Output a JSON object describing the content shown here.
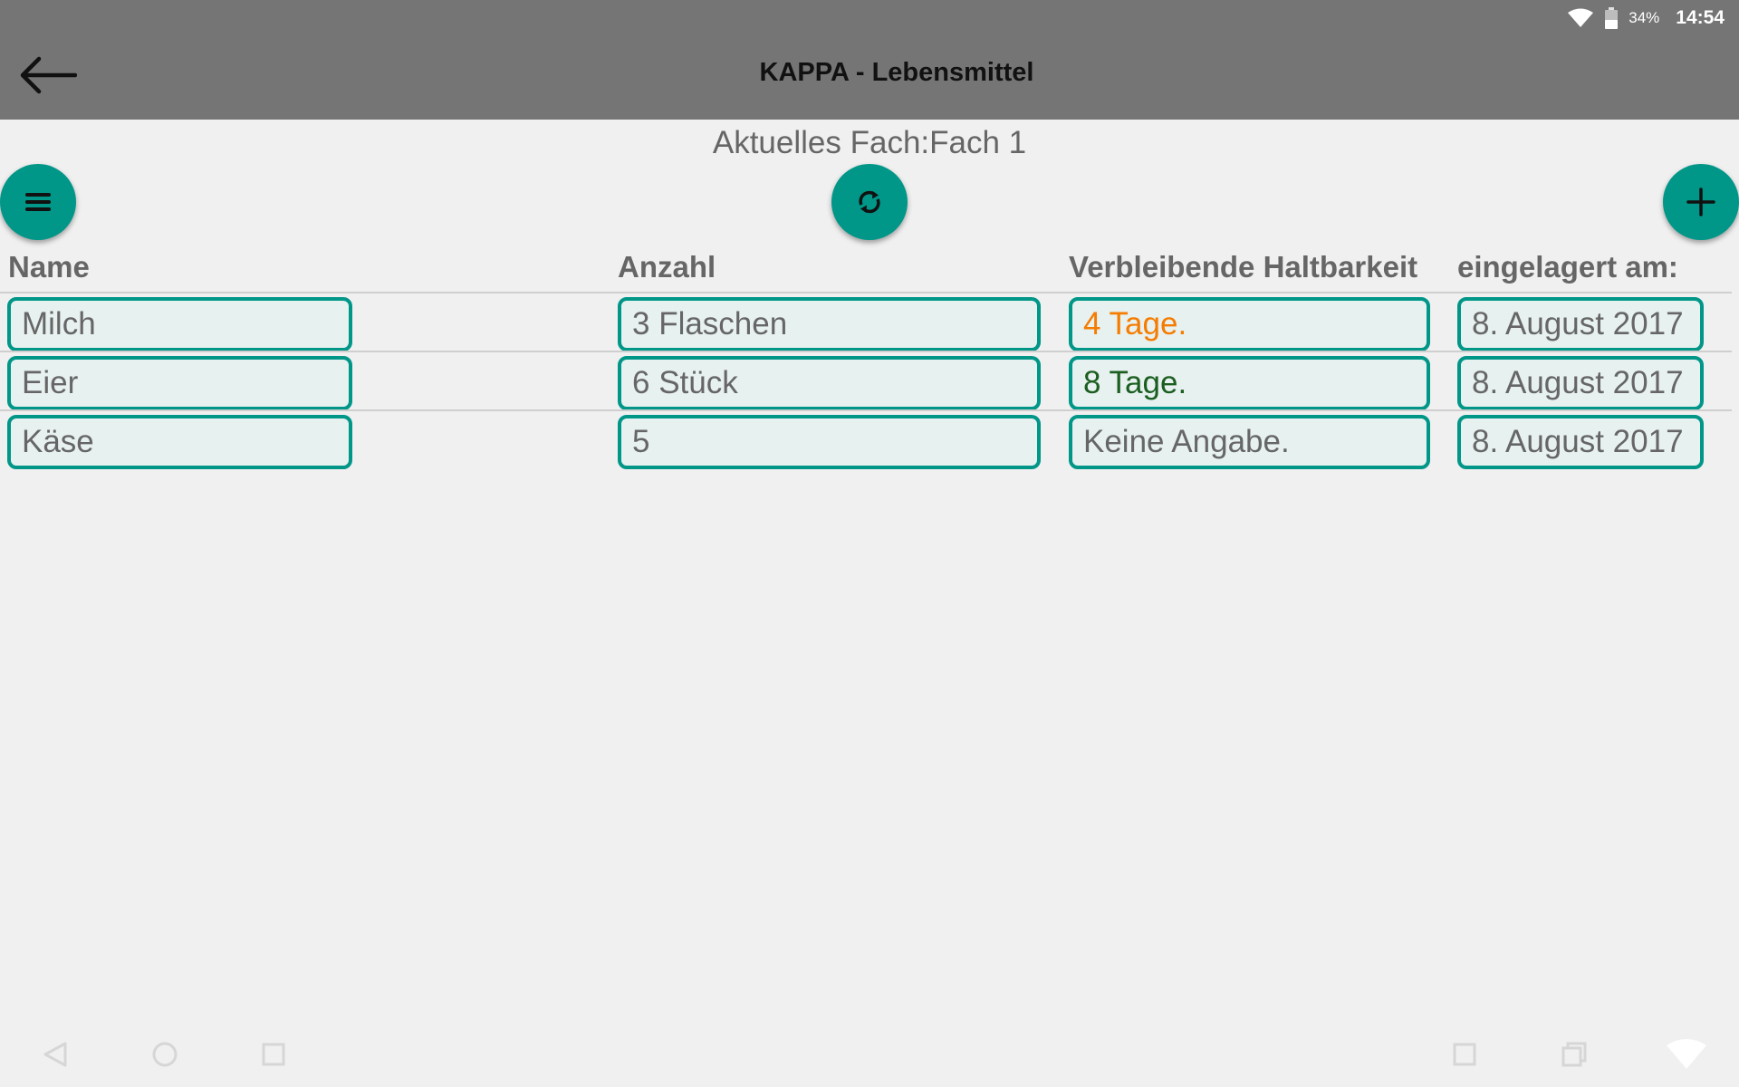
{
  "status": {
    "battery_pct": "34%",
    "time": "14:54"
  },
  "appbar": {
    "title": "KAPPA - Lebensmittel"
  },
  "current_compartment": "Aktuelles Fach:Fach 1",
  "colors": {
    "accent": "#009688",
    "appbar": "#757575",
    "expiry_warning": "#f57c00",
    "expiry_ok": "#1b5e20"
  },
  "table": {
    "headers": {
      "name": "Name",
      "amount": "Anzahl",
      "shelf_life": "Verbleibende Haltbarkeit",
      "stored_on": "eingelagert am:"
    },
    "rows": [
      {
        "name": "Milch",
        "amount": "3 Flaschen",
        "shelf_life": "4 Tage.",
        "stored_on": "8. August 2017"
      },
      {
        "name": "Eier",
        "amount": "6 Stück",
        "shelf_life": "8 Tage.",
        "stored_on": "8. August 2017"
      },
      {
        "name": "Käse",
        "amount": "5",
        "shelf_life": "Keine Angabe.",
        "stored_on": "8. August 2017"
      }
    ]
  }
}
